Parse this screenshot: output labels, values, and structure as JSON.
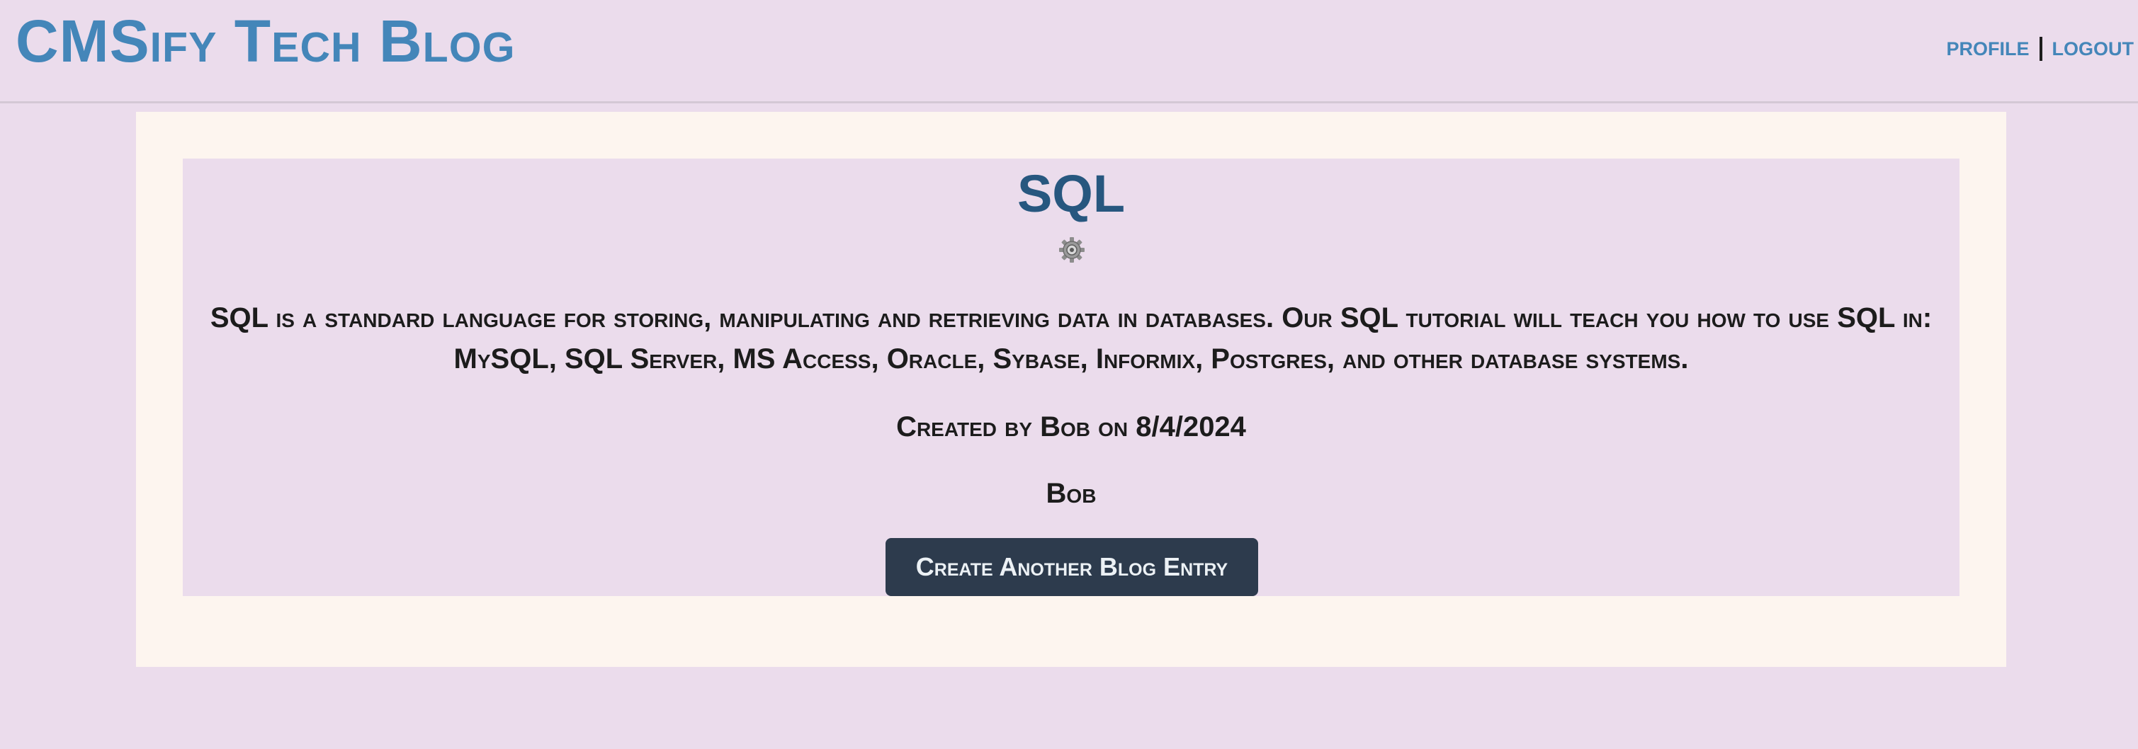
{
  "header": {
    "site_title": "CMSify Tech Blog",
    "nav": {
      "profile_label": "PROFILE",
      "logout_label": "LOGOUT"
    }
  },
  "post": {
    "title": "SQL",
    "icon": "gear-icon",
    "description": "SQL is a standard language for storing, manipulating and retrieving data in databases. Our SQL tutorial will teach you how to use SQL in: MySQL, SQL Server, MS Access, Oracle, Sybase, Informix, Postgres, and other database systems.",
    "meta": "Created by Bob on 8/4/2024",
    "author": "Bob",
    "create_button_label": "Create Another Blog Entry"
  },
  "colors": {
    "page_background": "#ebdcec",
    "panel_background": "#fdf5ef",
    "link_blue": "#4486b9",
    "title_blue": "#27577f",
    "button_background": "#2d3b4d",
    "text_dark": "#1c1c1c"
  }
}
